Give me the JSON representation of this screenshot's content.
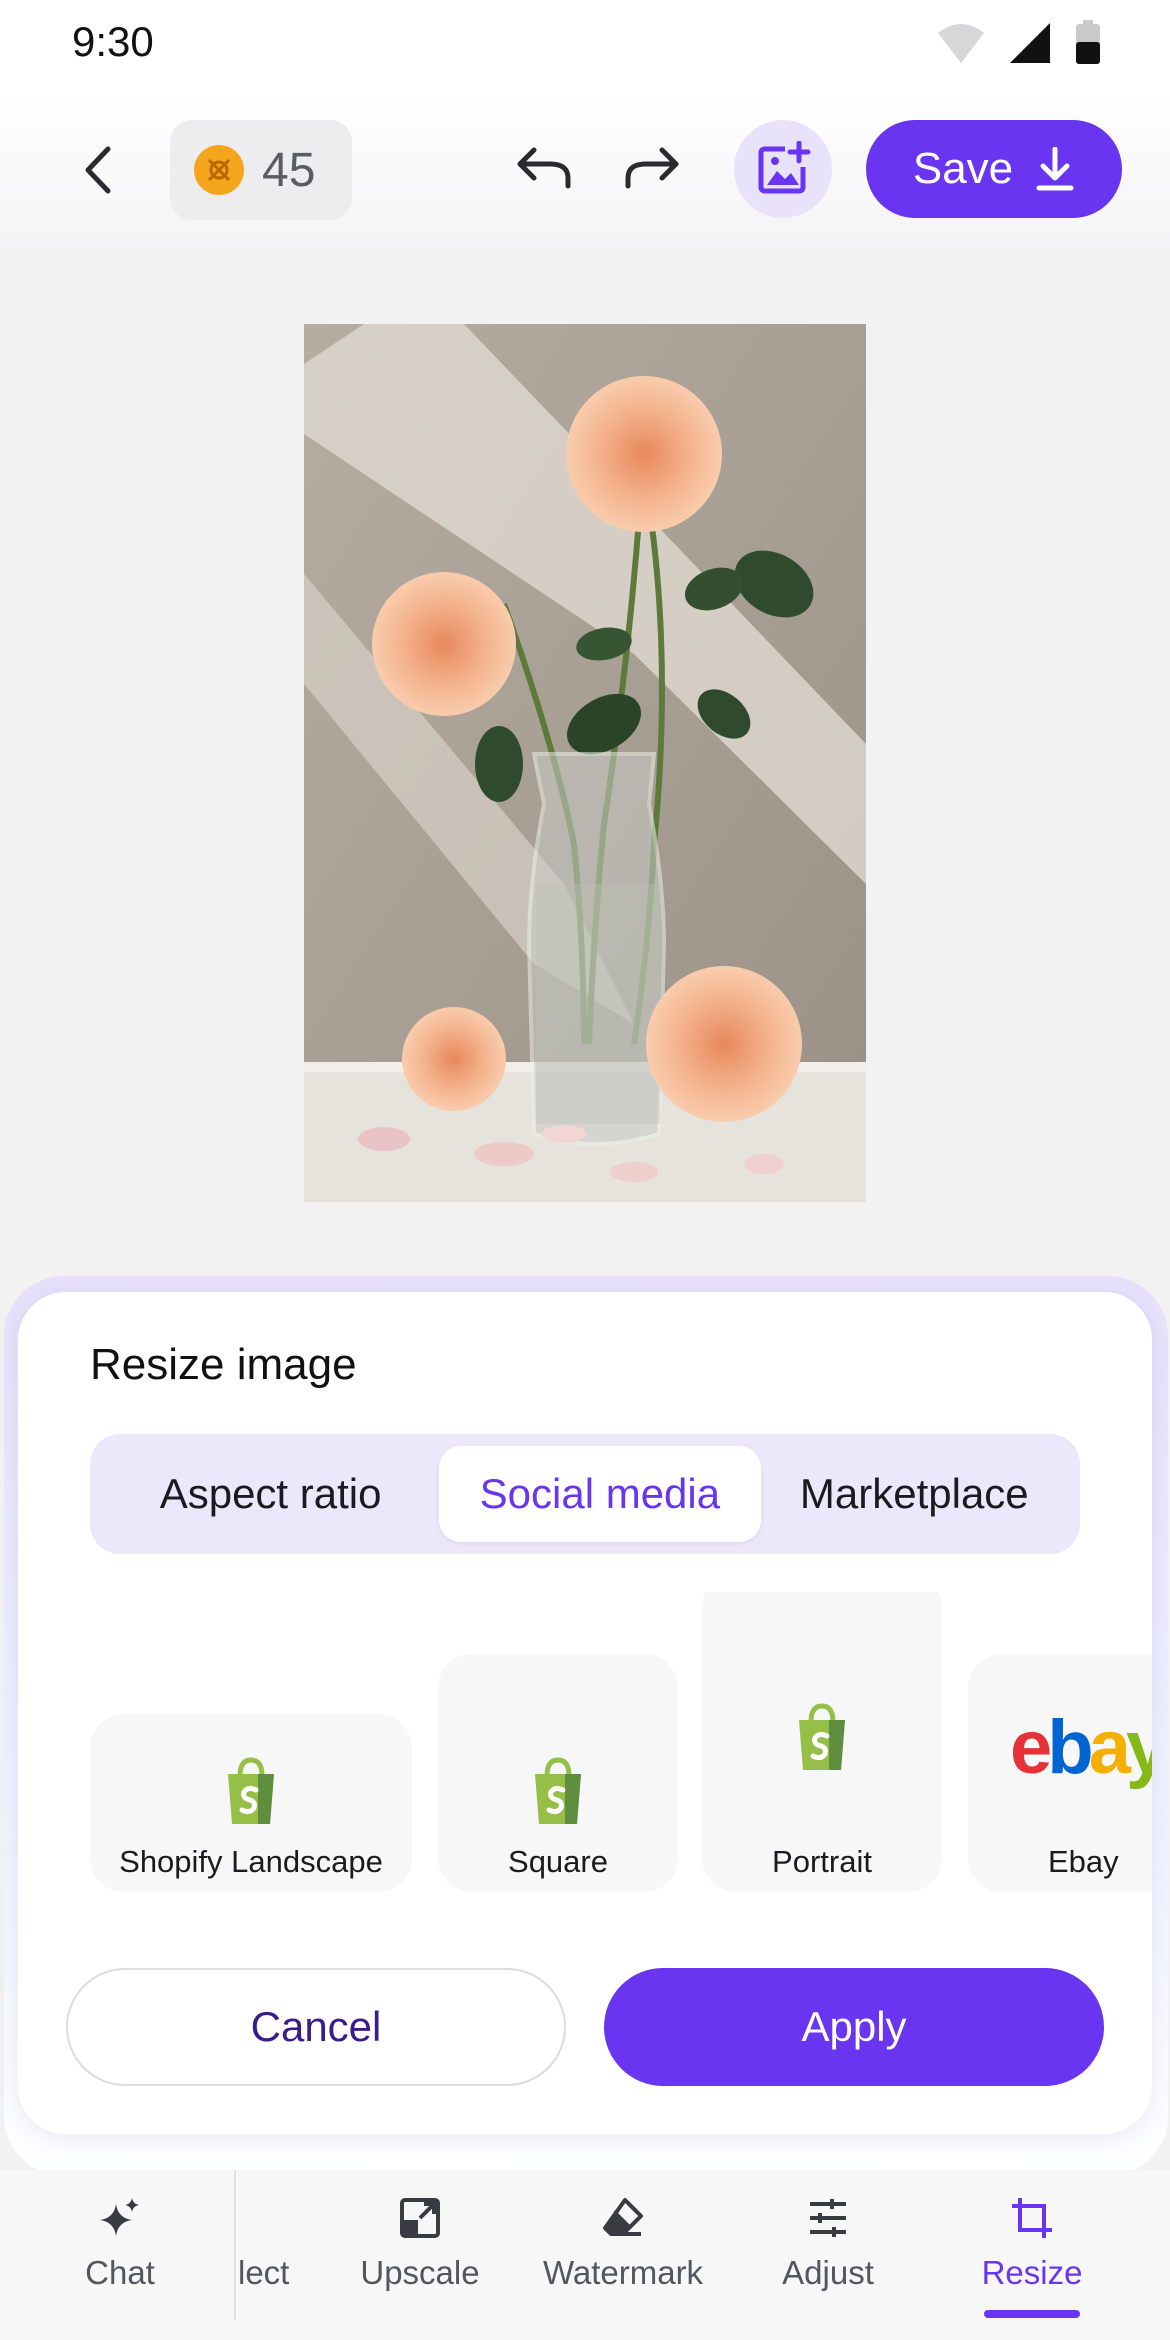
{
  "status_bar": {
    "time": "9:30"
  },
  "top_bar": {
    "credits": "45",
    "save_label": "Save"
  },
  "sheet": {
    "title": "Resize image",
    "tabs": [
      {
        "label": "Aspect ratio",
        "selected": false
      },
      {
        "label": "Social media",
        "selected": true
      },
      {
        "label": "Marketplace",
        "selected": false
      }
    ],
    "presets": [
      {
        "label": "Shopify Landscape",
        "icon": "shopify-icon"
      },
      {
        "label": "Square",
        "icon": "shopify-icon"
      },
      {
        "label": "Portrait",
        "icon": "shopify-icon"
      },
      {
        "label": "Ebay",
        "icon": "ebay-logo"
      }
    ],
    "ebay_logo_text": "ebay",
    "cancel_label": "Cancel",
    "apply_label": "Apply"
  },
  "bottom_nav": {
    "items": [
      {
        "label": "Chat",
        "icon": "sparkle-icon",
        "active": false
      },
      {
        "label": "lect",
        "icon": "",
        "active": false
      },
      {
        "label": "Upscale",
        "icon": "upscale-icon",
        "active": false
      },
      {
        "label": "Watermark",
        "icon": "eraser-icon",
        "active": false
      },
      {
        "label": "Adjust",
        "icon": "sliders-icon",
        "active": false
      },
      {
        "label": "Resize",
        "icon": "crop-icon",
        "active": true
      }
    ]
  },
  "colors": {
    "accent": "#6a35f0",
    "tab_bg": "#ece7fb",
    "coin": "#f4a51c",
    "shopify_green": "#95bf47"
  }
}
